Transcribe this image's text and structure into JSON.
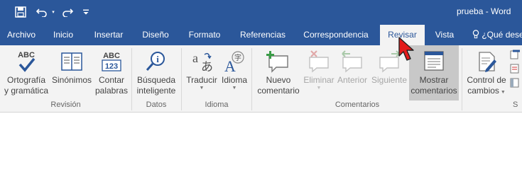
{
  "window": {
    "doc_title": "prueba - Word"
  },
  "qat": {
    "save_icon": "save-icon",
    "undo_icon": "undo-icon",
    "redo_icon": "redo-icon",
    "customize_icon": "customize-qat-icon"
  },
  "tabs": [
    {
      "label": "Archivo"
    },
    {
      "label": "Inicio"
    },
    {
      "label": "Insertar"
    },
    {
      "label": "Diseño"
    },
    {
      "label": "Formato"
    },
    {
      "label": "Referencias"
    },
    {
      "label": "Correspondencia"
    },
    {
      "label": "Revisar"
    },
    {
      "label": "Vista"
    }
  ],
  "tell_me": {
    "label": "¿Qué dese"
  },
  "ribbon": {
    "buttons": {
      "spelling": {
        "line1": "Ortografía",
        "line2": "y gramática"
      },
      "thesaurus": {
        "line1": "Sinónimos"
      },
      "word_count": {
        "line1": "Contar",
        "line2": "palabras"
      },
      "smart_lookup": {
        "line1": "Búsqueda",
        "line2": "inteligente"
      },
      "translate": {
        "line1": "Traducir"
      },
      "language": {
        "line1": "Idioma"
      },
      "new_comment": {
        "line1": "Nuevo",
        "line2": "comentario"
      },
      "delete": {
        "line1": "Eliminar"
      },
      "previous": {
        "line1": "Anterior"
      },
      "next": {
        "line1": "Siguiente"
      },
      "show_comments": {
        "line1": "Mostrar",
        "line2": "comentarios"
      },
      "track_changes": {
        "line1": "Control de",
        "line2": "cambios"
      }
    },
    "groups": {
      "proofing": "Revisión",
      "insights": "Datos",
      "language": "Idioma",
      "comments": "Comentarios",
      "tracking": "S"
    },
    "icons": {
      "abc_check": "ABC",
      "abc_123_top": "ABC",
      "abc_123_bottom": "123"
    }
  },
  "colors": {
    "accent": "#2b579a",
    "ribbon": "#f3f3f3"
  }
}
